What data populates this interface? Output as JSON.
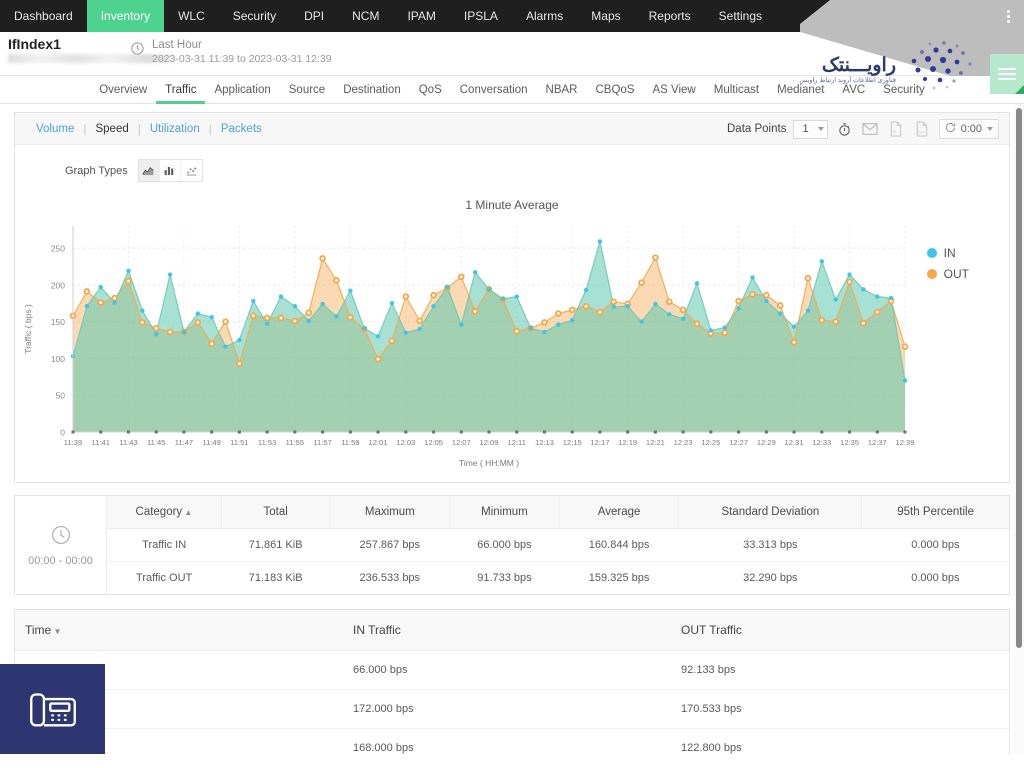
{
  "topnav": {
    "items": [
      {
        "label": "Dashboard",
        "active": false
      },
      {
        "label": "Inventory",
        "active": true
      },
      {
        "label": "WLC",
        "active": false
      },
      {
        "label": "Security",
        "active": false
      },
      {
        "label": "DPI",
        "active": false
      },
      {
        "label": "NCM",
        "active": false
      },
      {
        "label": "IPAM",
        "active": false
      },
      {
        "label": "IPSLA",
        "active": false
      },
      {
        "label": "Alarms",
        "active": false
      },
      {
        "label": "Maps",
        "active": false
      },
      {
        "label": "Reports",
        "active": false
      },
      {
        "label": "Settings",
        "active": false
      }
    ],
    "kebab_icon": "vertical-dots-icon"
  },
  "header": {
    "title": "IfIndex1",
    "clock_icon": "clock-icon",
    "time_label": "Last Hour",
    "time_range": "2023-03-31 11:39 to 2023-03-31 12:39",
    "logo_text_fa": "راویـــنتک",
    "logo_sub_fa": "فناوری اطلاعات آروند ارتباط راویس",
    "menu_icon": "hamburger-menu-icon"
  },
  "subnav": {
    "items": [
      {
        "label": "Overview",
        "active": false
      },
      {
        "label": "Traffic",
        "active": true
      },
      {
        "label": "Application",
        "active": false
      },
      {
        "label": "Source",
        "active": false
      },
      {
        "label": "Destination",
        "active": false
      },
      {
        "label": "QoS",
        "active": false
      },
      {
        "label": "Conversation",
        "active": false
      },
      {
        "label": "NBAR",
        "active": false
      },
      {
        "label": "CBQoS",
        "active": false
      },
      {
        "label": "AS View",
        "active": false
      },
      {
        "label": "Multicast",
        "active": false
      },
      {
        "label": "Medianet",
        "active": false
      },
      {
        "label": "AVC",
        "active": false
      },
      {
        "label": "Security",
        "active": false
      }
    ]
  },
  "metricbar": {
    "links": [
      {
        "label": "Volume",
        "active": false
      },
      {
        "label": "Speed",
        "active": true
      },
      {
        "label": "Utilization",
        "active": false
      },
      {
        "label": "Packets",
        "active": false
      }
    ],
    "separator": "|",
    "data_points_label": "Data Points",
    "data_points_value": "1",
    "tools": [
      {
        "name": "timer-icon"
      },
      {
        "name": "email-icon"
      },
      {
        "name": "pdf-export-icon"
      },
      {
        "name": "csv-export-icon"
      }
    ],
    "refresh_value": "0:00"
  },
  "graph_types": {
    "label": "Graph Types",
    "buttons": [
      {
        "name": "area-chart-icon",
        "active": true
      },
      {
        "name": "bar-chart-icon",
        "active": false
      },
      {
        "name": "scatter-chart-icon",
        "active": false
      }
    ]
  },
  "chart_data": {
    "type": "area",
    "title": "1 Minute Average",
    "xlabel": "Time ( HH:MM )",
    "ylabel": "Traffic ( bps )",
    "ylim": [
      0,
      280
    ],
    "yticks": [
      0,
      50,
      100,
      150,
      200,
      250
    ],
    "grid": true,
    "legend_position": "right",
    "x": [
      "11:39",
      "11:40",
      "11:41",
      "11:42",
      "11:43",
      "11:44",
      "11:45",
      "11:46",
      "11:47",
      "11:48",
      "11:49",
      "11:50",
      "11:51",
      "11:52",
      "11:53",
      "11:54",
      "11:55",
      "11:56",
      "11:57",
      "11:58",
      "11:59",
      "12:00",
      "12:01",
      "12:02",
      "12:03",
      "12:04",
      "12:05",
      "12:06",
      "12:07",
      "12:08",
      "12:09",
      "12:10",
      "12:11",
      "12:12",
      "12:13",
      "12:14",
      "12:15",
      "12:16",
      "12:17",
      "12:18",
      "12:19",
      "12:20",
      "12:21",
      "12:22",
      "12:23",
      "12:24",
      "12:25",
      "12:26",
      "12:27",
      "12:28",
      "12:29",
      "12:30",
      "12:31",
      "12:32",
      "12:33",
      "12:34",
      "12:35",
      "12:36",
      "12:37",
      "12:38",
      "12:39"
    ],
    "xticks": [
      "11:39",
      "11:41",
      "11:43",
      "11:45",
      "11:47",
      "11:49",
      "11:51",
      "11:53",
      "11:55",
      "11:57",
      "11:59",
      "12:01",
      "12:03",
      "12:05",
      "12:07",
      "12:09",
      "12:11",
      "12:13",
      "12:15",
      "12:17",
      "12:19",
      "12:21",
      "12:23",
      "12:25",
      "12:27",
      "12:29",
      "12:31",
      "12:33",
      "12:35",
      "12:37",
      "12:39"
    ],
    "series": [
      {
        "name": "IN",
        "color": "#3fc5e8",
        "values": [
          103,
          171,
          197,
          176,
          219,
          165,
          133,
          214,
          136,
          161,
          156,
          116,
          125,
          178,
          147,
          184,
          171,
          151,
          174,
          157,
          192,
          141,
          130,
          175,
          135,
          140,
          171,
          197,
          146,
          217,
          194,
          181,
          184,
          141,
          136,
          146,
          152,
          193,
          259,
          170,
          171,
          150,
          174,
          160,
          154,
          202,
          138,
          142,
          168,
          210,
          178,
          161,
          143,
          165,
          232,
          180,
          214,
          194,
          184,
          182,
          70
        ]
      },
      {
        "name": "OUT",
        "color": "#f5a84a",
        "values": [
          158,
          191,
          176,
          182,
          205,
          149,
          141,
          136,
          136,
          149,
          120,
          150,
          93,
          158,
          155,
          155,
          151,
          162,
          236,
          206,
          156,
          140,
          99,
          124,
          184,
          151,
          186,
          196,
          211,
          164,
          194,
          180,
          137,
          141,
          149,
          161,
          166,
          171,
          163,
          177,
          174,
          203,
          237,
          177,
          166,
          147,
          134,
          135,
          178,
          187,
          186,
          172,
          122,
          209,
          152,
          150,
          204,
          148,
          163,
          178,
          116
        ]
      }
    ]
  },
  "stats": {
    "period_icon": "clock-icon",
    "period_label": "00:00 - 00:00",
    "columns": [
      "Category",
      "Total",
      "Maximum",
      "Minimum",
      "Average",
      "Standard Deviation",
      "95th Percentile"
    ],
    "sort_column": "Category",
    "sort_dir": "asc",
    "rows": [
      {
        "category": "Traffic IN",
        "total": "71.861 KiB",
        "maximum": "257.867 bps",
        "minimum": "66.000 bps",
        "average": "160.844 bps",
        "stddev": "33.313 bps",
        "p95": "0.000 bps"
      },
      {
        "category": "Traffic OUT",
        "total": "71.183 KiB",
        "maximum": "236.533 bps",
        "minimum": "91.733 bps",
        "average": "159.325 bps",
        "stddev": "32.290 bps",
        "p95": "0.000 bps"
      }
    ]
  },
  "time_table": {
    "columns": [
      "Time",
      "IN Traffic",
      "OUT Traffic"
    ],
    "sort_column": "Time",
    "sort_dir": "desc",
    "rows": [
      {
        "time": "",
        "in": "66.000 bps",
        "out": "92.133 bps"
      },
      {
        "time": "",
        "in": "172.000 bps",
        "out": "170.533 bps"
      },
      {
        "time": "",
        "in": "168.000 bps",
        "out": "122.800 bps"
      }
    ]
  },
  "phone_widget": {
    "icon": "desk-phone-icon",
    "background": "#2e3672"
  },
  "colors": {
    "accent_green": "#4ed38e",
    "in_series": "#3fc5e8",
    "out_series": "#f5a84a",
    "overlap_fill": "#adc2a2",
    "link_blue": "#4d9fe0"
  }
}
